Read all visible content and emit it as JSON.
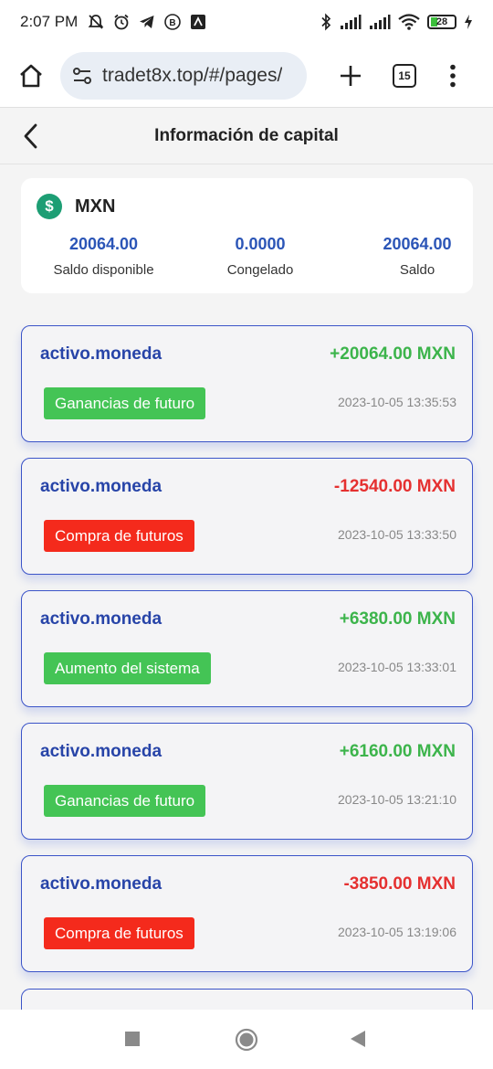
{
  "status_bar": {
    "time": "2:07 PM",
    "battery": "28",
    "battery_level": 0.28
  },
  "browser": {
    "url": "tradet8x.top/#/pages/",
    "tab_count": "15"
  },
  "header": {
    "title": "Información de capital"
  },
  "balance": {
    "currency": "MXN",
    "currency_symbol": "$",
    "available_value": "20064.00",
    "available_label": "Saldo disponible",
    "frozen_value": "0.0000",
    "frozen_label": "Congelado",
    "total_value": "20064.00",
    "total_label": "Saldo"
  },
  "transactions": [
    {
      "asset": "activo.moneda",
      "amount": "+20064.00 MXN",
      "type": "Ganancias de futuro",
      "time": "2023-10-05 13:35:53",
      "positive": true
    },
    {
      "asset": "activo.moneda",
      "amount": "-12540.00 MXN",
      "type": "Compra de futuros",
      "time": "2023-10-05 13:33:50",
      "positive": false
    },
    {
      "asset": "activo.moneda",
      "amount": "+6380.00 MXN",
      "type": "Aumento del sistema",
      "time": "2023-10-05 13:33:01",
      "positive": true
    },
    {
      "asset": "activo.moneda",
      "amount": "+6160.00 MXN",
      "type": "Ganancias de futuro",
      "time": "2023-10-05 13:21:10",
      "positive": true
    },
    {
      "asset": "activo.moneda",
      "amount": "-3850.00 MXN",
      "type": "Compra de futuros",
      "time": "2023-10-05 13:19:06",
      "positive": false
    }
  ],
  "colors": {
    "positive": "#3cb44b",
    "negative": "#e53030",
    "positive_badge": "#44c455",
    "negative_badge": "#f42a1c",
    "accent": "#2b55b7"
  },
  "icons": {
    "status_left": [
      "muted-notifications-icon",
      "alarm-icon",
      "telegram-icon",
      "b-app-icon",
      "app-icon"
    ],
    "status_right": [
      "bluetooth-icon",
      "signal-icon",
      "signal-icon",
      "wifi-icon",
      "battery-icon",
      "charging-icon"
    ],
    "browser": [
      "home-icon",
      "site-settings-icon",
      "plus-icon",
      "tabs-icon",
      "more-vert-icon"
    ],
    "nav": [
      "recents-icon",
      "home-circle-icon",
      "back-triangle-icon"
    ]
  }
}
